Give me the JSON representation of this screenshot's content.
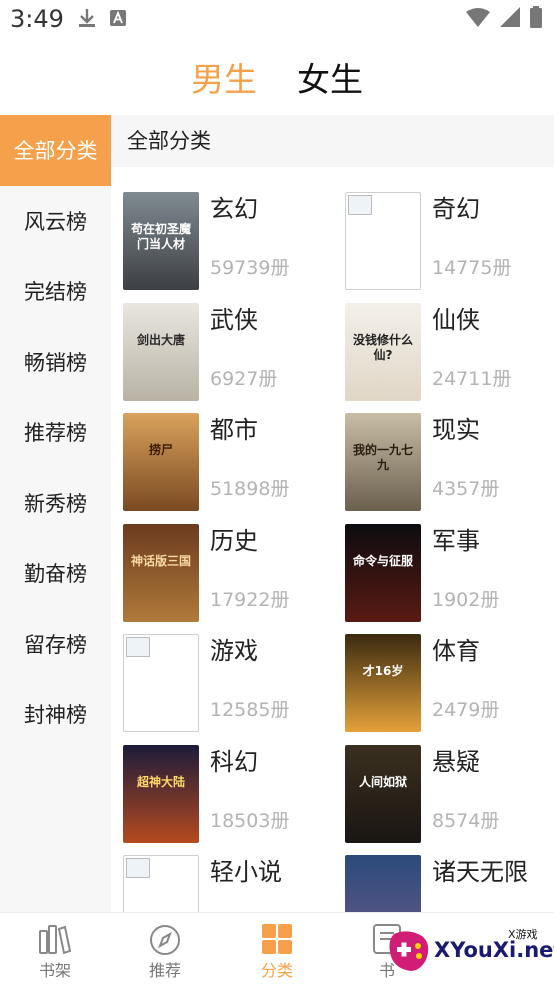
{
  "status_bar": {
    "time": "3:49"
  },
  "gender_tabs": [
    {
      "label": "男生",
      "active": true
    },
    {
      "label": "女生",
      "active": false
    }
  ],
  "sidebar": {
    "items": [
      {
        "label": "全部分类",
        "active": true
      },
      {
        "label": "风云榜"
      },
      {
        "label": "完结榜"
      },
      {
        "label": "畅销榜"
      },
      {
        "label": "推荐榜"
      },
      {
        "label": "新秀榜"
      },
      {
        "label": "勤奋榜"
      },
      {
        "label": "留存榜"
      },
      {
        "label": "封神榜"
      }
    ]
  },
  "content": {
    "header": "全部分类",
    "categories": [
      {
        "title": "玄幻",
        "count": "59739册",
        "cover_text": "苟在初圣魔门当人材"
      },
      {
        "title": "奇幻",
        "count": "14775册",
        "cover_text": ""
      },
      {
        "title": "武侠",
        "count": "6927册",
        "cover_text": "剑出大唐"
      },
      {
        "title": "仙侠",
        "count": "24711册",
        "cover_text": "没钱修什么仙?"
      },
      {
        "title": "都市",
        "count": "51898册",
        "cover_text": "捞尸"
      },
      {
        "title": "现实",
        "count": "4357册",
        "cover_text": "我的一九七九"
      },
      {
        "title": "历史",
        "count": "17922册",
        "cover_text": "神话版三国"
      },
      {
        "title": "军事",
        "count": "1902册",
        "cover_text": "命令与征服"
      },
      {
        "title": "游戏",
        "count": "12585册",
        "cover_text": ""
      },
      {
        "title": "体育",
        "count": "2479册",
        "cover_text": "才16岁"
      },
      {
        "title": "科幻",
        "count": "18503册",
        "cover_text": "超神大陆"
      },
      {
        "title": "悬疑",
        "count": "8574册",
        "cover_text": "人间如狱"
      },
      {
        "title": "轻小说",
        "count": "",
        "cover_text": ""
      },
      {
        "title": "诸天无限",
        "count": "",
        "cover_text": ""
      }
    ]
  },
  "bottom_nav": [
    {
      "label": "书架",
      "icon": "bookshelf-icon"
    },
    {
      "label": "推荐",
      "icon": "compass-icon"
    },
    {
      "label": "分类",
      "icon": "category-grid-icon",
      "active": true
    },
    {
      "label": "书",
      "icon": "book-icon"
    }
  ],
  "watermark": {
    "text": "XYouXi.net",
    "small": "X游戏"
  },
  "colors": {
    "accent": "#f5a04a",
    "sidebar_bg": "#f7f7f7",
    "count_gray": "#b3b3b3"
  }
}
